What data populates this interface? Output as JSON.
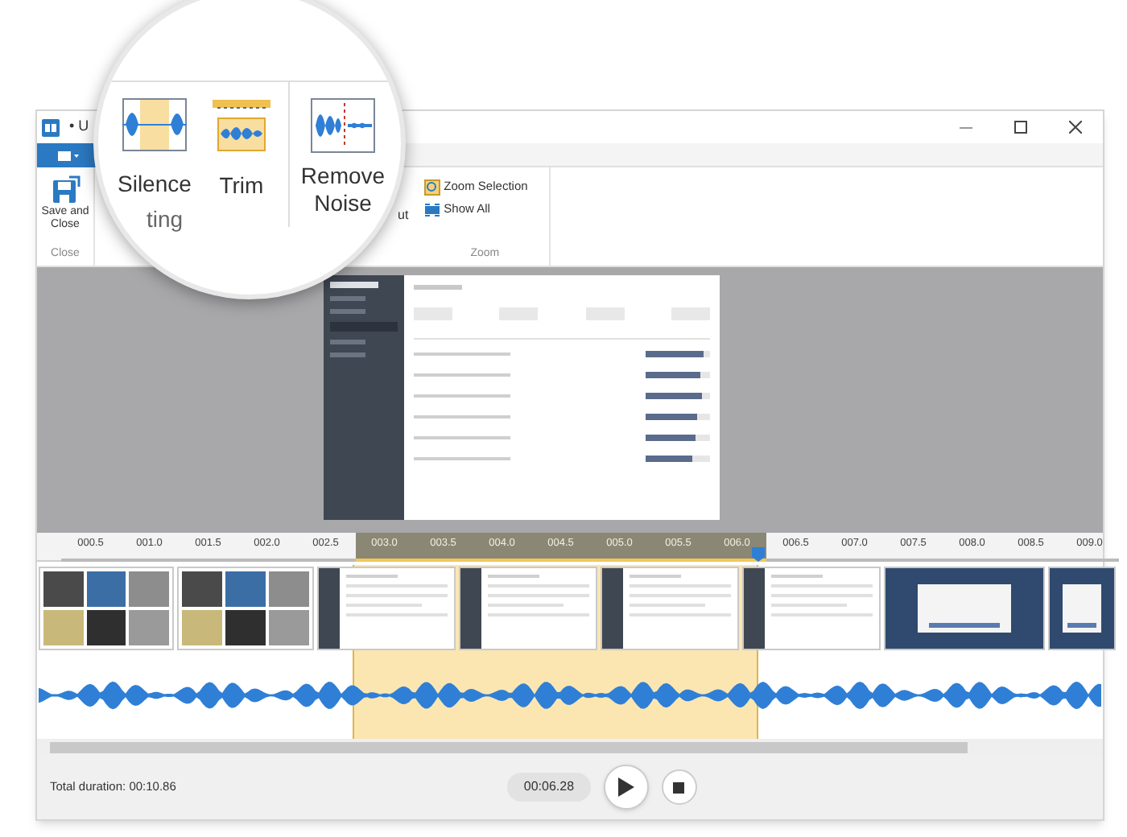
{
  "window": {
    "title": "• U"
  },
  "ribbon": {
    "groups": [
      {
        "label": "Close",
        "buttons": [
          {
            "label": "Save and Close",
            "kind": "save"
          }
        ]
      },
      {
        "label": "Zoom",
        "buttons": [
          {
            "label": "Zoom Selection",
            "kind": "zoom"
          },
          {
            "label": "Show All",
            "kind": "showall"
          }
        ]
      }
    ],
    "cut_label": "ut"
  },
  "magnifier": {
    "group_label": "ting",
    "buttons": [
      {
        "label": "Silence",
        "kind": "silence"
      },
      {
        "label": "Trim",
        "kind": "trim"
      },
      {
        "label": "Remove Noise",
        "kind": "noise"
      }
    ]
  },
  "timeline": {
    "ticks": [
      {
        "label": "000.5",
        "selected": false
      },
      {
        "label": "001.0",
        "selected": false
      },
      {
        "label": "001.5",
        "selected": false
      },
      {
        "label": "002.0",
        "selected": false
      },
      {
        "label": "002.5",
        "selected": false
      },
      {
        "label": "003.0",
        "selected": true
      },
      {
        "label": "003.5",
        "selected": true
      },
      {
        "label": "004.0",
        "selected": true
      },
      {
        "label": "004.5",
        "selected": true
      },
      {
        "label": "005.0",
        "selected": true
      },
      {
        "label": "005.5",
        "selected": true
      },
      {
        "label": "006.0",
        "selected": true
      },
      {
        "label": "006.5",
        "selected": false
      },
      {
        "label": "007.0",
        "selected": false
      },
      {
        "label": "007.5",
        "selected": false
      },
      {
        "label": "008.0",
        "selected": false
      },
      {
        "label": "008.5",
        "selected": false
      },
      {
        "label": "009.0",
        "selected": false
      }
    ],
    "frames": [
      {
        "kind": "photos"
      },
      {
        "kind": "photos"
      },
      {
        "kind": "dashboard"
      },
      {
        "kind": "dashboard"
      },
      {
        "kind": "dashboard"
      },
      {
        "kind": "dashboard"
      },
      {
        "kind": "dialog"
      },
      {
        "kind": "dialog"
      }
    ]
  },
  "footer": {
    "total_duration": "Total duration: 00:10.86",
    "current_time": "00:06.28"
  }
}
